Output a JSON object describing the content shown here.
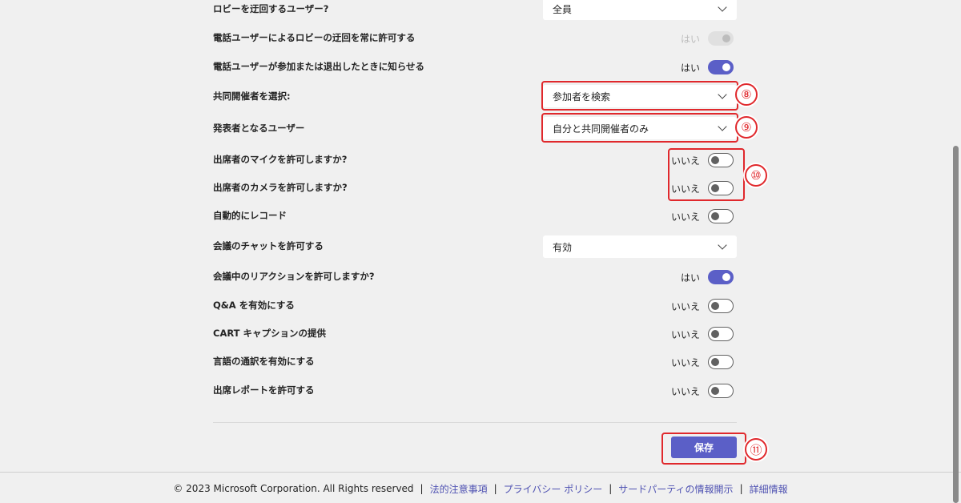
{
  "settings": {
    "lobby_bypass": {
      "label": "ロビーを迂回するユーザー?",
      "value": "全員"
    },
    "phone_bypass": {
      "label": "電話ユーザーによるロビーの迂回を常に許可する",
      "state": "はい"
    },
    "phone_notify": {
      "label": "電話ユーザーが参加または退出したときに知らせる",
      "state": "はい"
    },
    "co_organizers": {
      "label": "共同開催者を選択:",
      "placeholder": "参加者を検索"
    },
    "presenters": {
      "label": "発表者となるユーザー",
      "value": "自分と共同開催者のみ"
    },
    "allow_mic": {
      "label": "出席者のマイクを許可しますか?",
      "state": "いいえ"
    },
    "allow_camera": {
      "label": "出席者のカメラを許可しますか?",
      "state": "いいえ"
    },
    "auto_record": {
      "label": "自動的にレコード",
      "state": "いいえ"
    },
    "meeting_chat": {
      "label": "会議のチャットを許可する",
      "value": "有効"
    },
    "reactions": {
      "label": "会議中のリアクションを許可しますか?",
      "state": "はい"
    },
    "qna": {
      "label": "Q&A を有効にする",
      "state": "いいえ"
    },
    "cart": {
      "label": "CART キャプションの提供",
      "state": "いいえ"
    },
    "interpretation": {
      "label": "言語の通訳を有効にする",
      "state": "いいえ"
    },
    "attendance": {
      "label": "出席レポートを許可する",
      "state": "いいえ"
    }
  },
  "save_label": "保存",
  "annotations": {
    "a8": "⑧",
    "a9": "⑨",
    "a10": "⑩",
    "a11": "⑪"
  },
  "footer": {
    "copyright": "© 2023 Microsoft Corporation. All Rights reserved",
    "links": [
      "法的注意事項",
      "プライバシー ポリシー",
      "サードパーティの情報開示",
      "詳細情報"
    ],
    "separator": "|"
  },
  "colors": {
    "accent": "#5b5fc7",
    "annotation": "#e0282c",
    "link": "#4f52b2"
  }
}
